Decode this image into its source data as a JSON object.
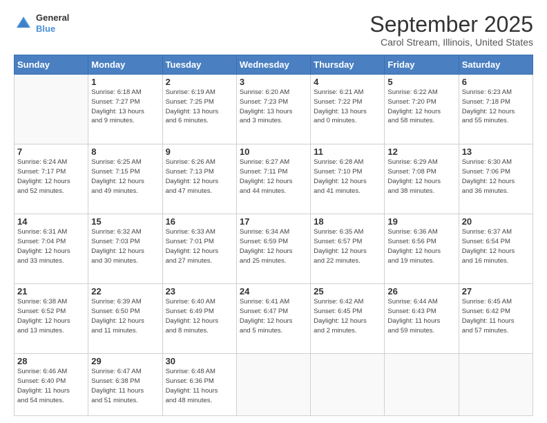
{
  "logo": {
    "line1": "General",
    "line2": "Blue"
  },
  "title": "September 2025",
  "subtitle": "Carol Stream, Illinois, United States",
  "weekdays": [
    "Sunday",
    "Monday",
    "Tuesday",
    "Wednesday",
    "Thursday",
    "Friday",
    "Saturday"
  ],
  "weeks": [
    [
      {
        "num": "",
        "info": ""
      },
      {
        "num": "1",
        "info": "Sunrise: 6:18 AM\nSunset: 7:27 PM\nDaylight: 13 hours\nand 9 minutes."
      },
      {
        "num": "2",
        "info": "Sunrise: 6:19 AM\nSunset: 7:25 PM\nDaylight: 13 hours\nand 6 minutes."
      },
      {
        "num": "3",
        "info": "Sunrise: 6:20 AM\nSunset: 7:23 PM\nDaylight: 13 hours\nand 3 minutes."
      },
      {
        "num": "4",
        "info": "Sunrise: 6:21 AM\nSunset: 7:22 PM\nDaylight: 13 hours\nand 0 minutes."
      },
      {
        "num": "5",
        "info": "Sunrise: 6:22 AM\nSunset: 7:20 PM\nDaylight: 12 hours\nand 58 minutes."
      },
      {
        "num": "6",
        "info": "Sunrise: 6:23 AM\nSunset: 7:18 PM\nDaylight: 12 hours\nand 55 minutes."
      }
    ],
    [
      {
        "num": "7",
        "info": "Sunrise: 6:24 AM\nSunset: 7:17 PM\nDaylight: 12 hours\nand 52 minutes."
      },
      {
        "num": "8",
        "info": "Sunrise: 6:25 AM\nSunset: 7:15 PM\nDaylight: 12 hours\nand 49 minutes."
      },
      {
        "num": "9",
        "info": "Sunrise: 6:26 AM\nSunset: 7:13 PM\nDaylight: 12 hours\nand 47 minutes."
      },
      {
        "num": "10",
        "info": "Sunrise: 6:27 AM\nSunset: 7:11 PM\nDaylight: 12 hours\nand 44 minutes."
      },
      {
        "num": "11",
        "info": "Sunrise: 6:28 AM\nSunset: 7:10 PM\nDaylight: 12 hours\nand 41 minutes."
      },
      {
        "num": "12",
        "info": "Sunrise: 6:29 AM\nSunset: 7:08 PM\nDaylight: 12 hours\nand 38 minutes."
      },
      {
        "num": "13",
        "info": "Sunrise: 6:30 AM\nSunset: 7:06 PM\nDaylight: 12 hours\nand 36 minutes."
      }
    ],
    [
      {
        "num": "14",
        "info": "Sunrise: 6:31 AM\nSunset: 7:04 PM\nDaylight: 12 hours\nand 33 minutes."
      },
      {
        "num": "15",
        "info": "Sunrise: 6:32 AM\nSunset: 7:03 PM\nDaylight: 12 hours\nand 30 minutes."
      },
      {
        "num": "16",
        "info": "Sunrise: 6:33 AM\nSunset: 7:01 PM\nDaylight: 12 hours\nand 27 minutes."
      },
      {
        "num": "17",
        "info": "Sunrise: 6:34 AM\nSunset: 6:59 PM\nDaylight: 12 hours\nand 25 minutes."
      },
      {
        "num": "18",
        "info": "Sunrise: 6:35 AM\nSunset: 6:57 PM\nDaylight: 12 hours\nand 22 minutes."
      },
      {
        "num": "19",
        "info": "Sunrise: 6:36 AM\nSunset: 6:56 PM\nDaylight: 12 hours\nand 19 minutes."
      },
      {
        "num": "20",
        "info": "Sunrise: 6:37 AM\nSunset: 6:54 PM\nDaylight: 12 hours\nand 16 minutes."
      }
    ],
    [
      {
        "num": "21",
        "info": "Sunrise: 6:38 AM\nSunset: 6:52 PM\nDaylight: 12 hours\nand 13 minutes."
      },
      {
        "num": "22",
        "info": "Sunrise: 6:39 AM\nSunset: 6:50 PM\nDaylight: 12 hours\nand 11 minutes."
      },
      {
        "num": "23",
        "info": "Sunrise: 6:40 AM\nSunset: 6:49 PM\nDaylight: 12 hours\nand 8 minutes."
      },
      {
        "num": "24",
        "info": "Sunrise: 6:41 AM\nSunset: 6:47 PM\nDaylight: 12 hours\nand 5 minutes."
      },
      {
        "num": "25",
        "info": "Sunrise: 6:42 AM\nSunset: 6:45 PM\nDaylight: 12 hours\nand 2 minutes."
      },
      {
        "num": "26",
        "info": "Sunrise: 6:44 AM\nSunset: 6:43 PM\nDaylight: 11 hours\nand 59 minutes."
      },
      {
        "num": "27",
        "info": "Sunrise: 6:45 AM\nSunset: 6:42 PM\nDaylight: 11 hours\nand 57 minutes."
      }
    ],
    [
      {
        "num": "28",
        "info": "Sunrise: 6:46 AM\nSunset: 6:40 PM\nDaylight: 11 hours\nand 54 minutes."
      },
      {
        "num": "29",
        "info": "Sunrise: 6:47 AM\nSunset: 6:38 PM\nDaylight: 11 hours\nand 51 minutes."
      },
      {
        "num": "30",
        "info": "Sunrise: 6:48 AM\nSunset: 6:36 PM\nDaylight: 11 hours\nand 48 minutes."
      },
      {
        "num": "",
        "info": ""
      },
      {
        "num": "",
        "info": ""
      },
      {
        "num": "",
        "info": ""
      },
      {
        "num": "",
        "info": ""
      }
    ]
  ]
}
